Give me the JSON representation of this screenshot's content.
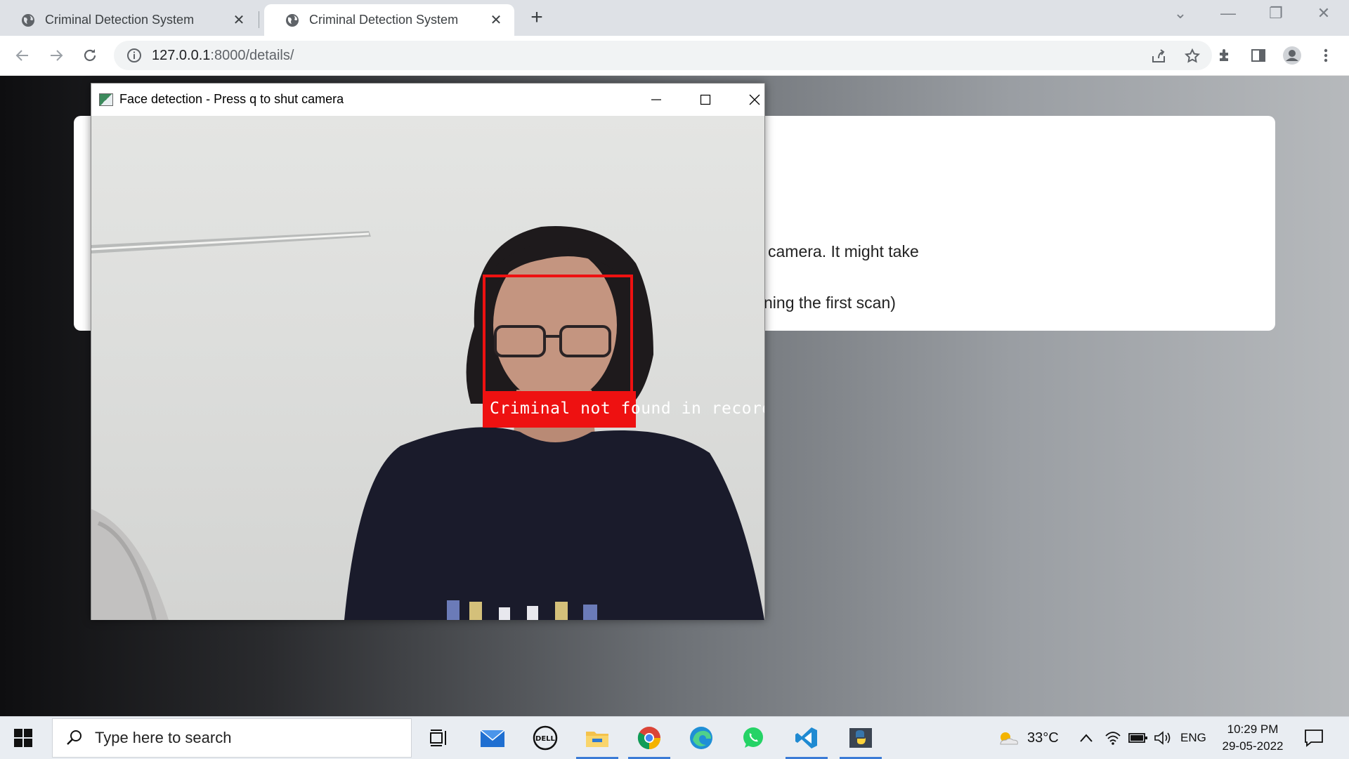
{
  "browser": {
    "tabs": [
      {
        "title": "Criminal Detection System",
        "active": false
      },
      {
        "title": "Criminal Detection System",
        "active": true
      }
    ],
    "url_host": "127.0.0.1",
    "url_path": ":8000/details/"
  },
  "page": {
    "card_line_1": "camera. It might take",
    "card_line_2": "ning the first scan)"
  },
  "camera_window": {
    "title": "Face detection - Press q to shut camera",
    "detection_label": "Criminal not found in records",
    "box_color": "#ee1111"
  },
  "taskbar": {
    "search_placeholder": "Type here to search",
    "weather": "33°C",
    "language": "ENG",
    "time": "10:29 PM",
    "date": "29-05-2022",
    "apps": [
      "task-view",
      "mail",
      "dell",
      "file-explorer",
      "chrome",
      "edge",
      "whatsapp",
      "vscode",
      "python"
    ]
  }
}
